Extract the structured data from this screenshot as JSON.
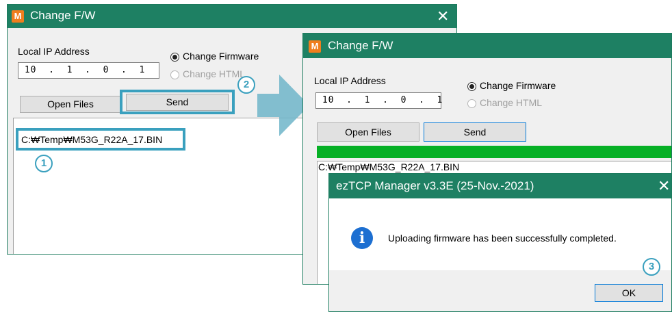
{
  "window1": {
    "logo": "M",
    "title": "Change F/W",
    "close": "✕",
    "ip_label": "Local IP Address",
    "ip_value": " 10  .  1  .  0  .  1",
    "radio_firmware": "Change Firmware",
    "radio_html": "Change HTML",
    "open_files": "Open Files",
    "send": "Send",
    "file_path": "C:₩Temp₩M53G_R22A_17.BIN",
    "step1": "1",
    "step2": "2"
  },
  "window2": {
    "logo": "M",
    "title": "Change F/W",
    "ip_label": "Local IP Address",
    "ip_value": " 10  .  1  .  0  .  1",
    "radio_firmware": "Change Firmware",
    "radio_html": "Change HTML",
    "open_files": "Open Files",
    "send": "Send",
    "file_path": "C:₩Temp₩M53G_R22A_17.BIN",
    "progress": 1.0
  },
  "dialog": {
    "title": "ezTCP Manager v3.3E (25-Nov.-2021)",
    "close": "✕",
    "icon": "i",
    "message": "Uploading firmware has been successfully completed.",
    "ok": "OK",
    "step3": "3"
  },
  "colors": {
    "titlebar": "#1e8063",
    "highlight": "#3aa0be",
    "progress": "#06b025",
    "info_icon": "#1d6fd1"
  }
}
